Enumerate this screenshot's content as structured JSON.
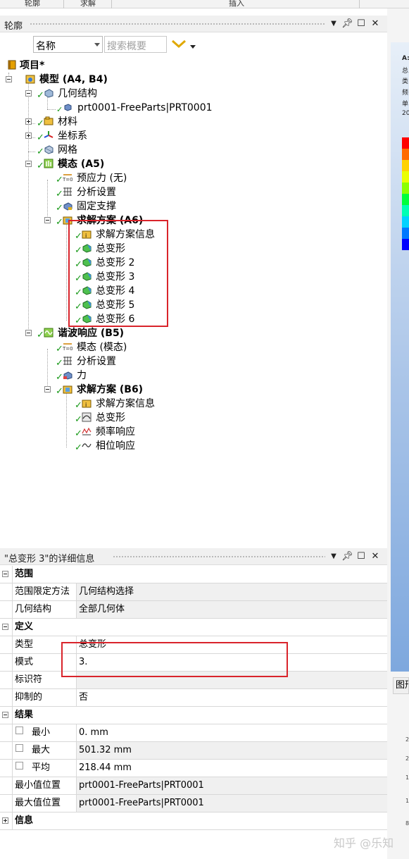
{
  "ribbon": {
    "labels": [
      "轮廓",
      "求解",
      "插入"
    ]
  },
  "outline_panel": {
    "title": "轮廓",
    "sort_combo": "名称",
    "search_placeholder": "搜索概要",
    "tree": [
      {
        "label": "项目*",
        "bold": true,
        "icon": "project-icon"
      },
      {
        "label": "模型 (A4, B4)",
        "bold": true,
        "icon": "model-icon"
      },
      {
        "label": "几何结构",
        "icon": "geometry-icon"
      },
      {
        "label": "prt0001-FreeParts|PRT0001",
        "icon": "part-icon"
      },
      {
        "label": "材料",
        "icon": "materials-icon"
      },
      {
        "label": "坐标系",
        "icon": "coordinate-system-icon"
      },
      {
        "label": "网格",
        "icon": "mesh-icon"
      },
      {
        "label": "模态 (A5)",
        "bold": true,
        "icon": "modal-icon"
      },
      {
        "label": "预应力 (无)",
        "icon": "prestress-icon"
      },
      {
        "label": "分析设置",
        "icon": "analysis-settings-icon"
      },
      {
        "label": "固定支撑",
        "icon": "fixed-support-icon"
      },
      {
        "label": "求解方案 (A6)",
        "bold": true,
        "icon": "solution-icon"
      },
      {
        "label": "求解方案信息",
        "icon": "solution-info-icon"
      },
      {
        "label": "总变形",
        "icon": "total-deformation-icon"
      },
      {
        "label": "总变形 2",
        "icon": "total-deformation-icon"
      },
      {
        "label": "总变形 3",
        "icon": "total-deformation-icon"
      },
      {
        "label": "总变形 4",
        "icon": "total-deformation-icon"
      },
      {
        "label": "总变形 5",
        "icon": "total-deformation-icon"
      },
      {
        "label": "总变形 6",
        "icon": "total-deformation-icon"
      },
      {
        "label": "谐波响应 (B5)",
        "bold": true,
        "icon": "harmonic-response-icon"
      },
      {
        "label": "模态 (模态)",
        "icon": "modal-ref-icon"
      },
      {
        "label": "分析设置",
        "icon": "analysis-settings-icon"
      },
      {
        "label": "力",
        "icon": "force-icon"
      },
      {
        "label": "求解方案 (B6)",
        "bold": true,
        "icon": "solution-icon"
      },
      {
        "label": "求解方案信息",
        "icon": "solution-info-icon"
      },
      {
        "label": "总变形",
        "icon": "total-deformation-icon"
      },
      {
        "label": "频率响应",
        "icon": "frequency-response-icon"
      },
      {
        "label": "相位响应",
        "icon": "phase-response-icon"
      }
    ]
  },
  "details_panel": {
    "title": "\"总变形 3\"的详细信息",
    "groups": {
      "scope": "范围",
      "definition": "定义",
      "results": "结果",
      "info": "信息"
    },
    "rows": {
      "scoping_method": {
        "label": "范围限定方法",
        "value": "几何结构选择"
      },
      "geometry": {
        "label": "几何结构",
        "value": "全部几何体"
      },
      "type": {
        "label": "类型",
        "value": "总变形"
      },
      "mode": {
        "label": "模式",
        "value": "3."
      },
      "identifier": {
        "label": "标识符",
        "value": ""
      },
      "suppressed": {
        "label": "抑制的",
        "value": "否"
      },
      "minimum": {
        "label": "最小",
        "value": "0. mm"
      },
      "maximum": {
        "label": "最大",
        "value": "501.32 mm"
      },
      "average": {
        "label": "平均",
        "value": "218.44 mm"
      },
      "min_location": {
        "label": "最小值位置",
        "value": "prt0001-FreeParts|PRT0001"
      },
      "max_location": {
        "label": "最大值位置",
        "value": "prt0001-FreeParts|PRT0001"
      }
    }
  },
  "right_panel": {
    "legend_text": [
      "A:",
      "总",
      "类",
      "频",
      "单",
      "20"
    ],
    "legend_colors": [
      "#ff0000",
      "#ff6a00",
      "#ffd200",
      "#eaff00",
      "#8cff00",
      "#00ff3c",
      "#00ffb4",
      "#00d2ff",
      "#0078ff",
      "#0000ff"
    ],
    "tab_label": "图形",
    "axis_numbers": [
      "2",
      "2",
      "1",
      "1",
      "8"
    ]
  },
  "colors": {
    "accent_check": "#1a9a1a",
    "highlight_box": "#d9242b",
    "filter_icon": "#e0a800"
  },
  "watermark": "知乎 @乐知"
}
